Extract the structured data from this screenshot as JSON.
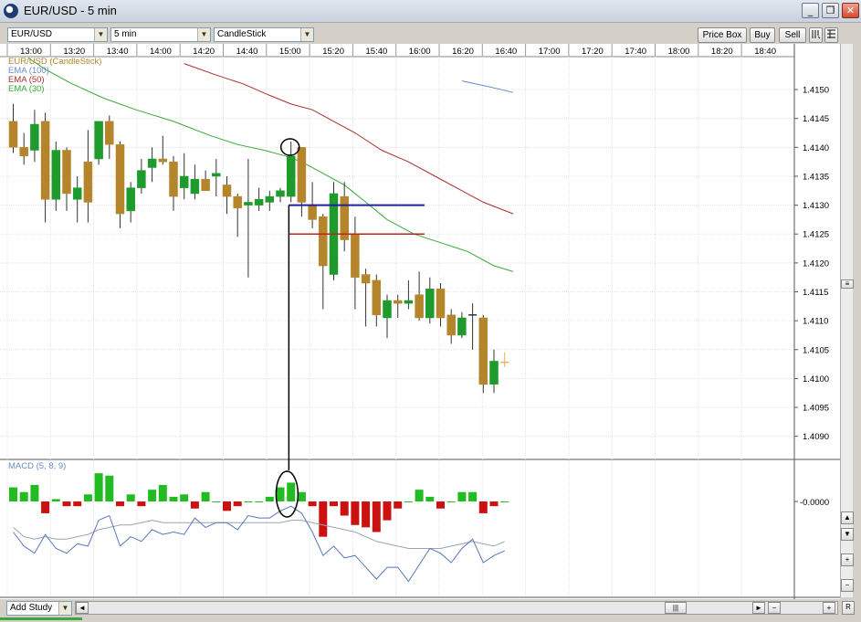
{
  "window": {
    "title": "EUR/USD - 5 min",
    "minimize": "_",
    "restore": "❐",
    "close": "✕"
  },
  "toolbar": {
    "symbol": "EUR/USD",
    "period": "5 min",
    "chart_type": "CandleStick",
    "price_box": "Price Box",
    "buy": "Buy",
    "sell": "Sell"
  },
  "footer": {
    "add_study": "Add Study",
    "scroll_left": "◄",
    "scroll_right": "►",
    "zoom_out": "−",
    "zoom_in": "+",
    "reset": "R",
    "grip": "|||"
  },
  "right_scroll": {
    "up": "▲",
    "down": "▼",
    "plus": "+",
    "minus": "−"
  },
  "colors": {
    "up_candle": "#1f9a2c",
    "down_candle": "#b5852c",
    "ema100": "#6a8cc8",
    "ema50": "#a8302a",
    "ema30": "#3aa83a",
    "macd_up": "#22bb22",
    "macd_down": "#cc1111",
    "support_line": "#22229a",
    "resist_line": "#bb2222"
  },
  "chart_data": {
    "type": "candlestick",
    "timeframe": "5 min",
    "x_ticks": [
      "13:00",
      "13:20",
      "13:40",
      "14:00",
      "14:20",
      "14:40",
      "15:00",
      "15:20",
      "15:40",
      "16:00",
      "16:20",
      "16:40",
      "17:00",
      "17:20",
      "17:40",
      "18:00",
      "18:20",
      "18:40"
    ],
    "y_ticks": [
      "1.4150",
      "1.4145",
      "1.4140",
      "1.4135",
      "1.4130",
      "1.4125",
      "1.4120",
      "1.4115",
      "1.4110",
      "1.4105",
      "1.4100",
      "1.4095",
      "1.4090"
    ],
    "ylim": [
      1.4086,
      1.41557
    ],
    "legend": [
      {
        "name": "EUR/USD (CandleStick)",
        "color": "#b5852c"
      },
      {
        "name": "EMA (100)",
        "color": "#6a8cc8"
      },
      {
        "name": "EMA (50)",
        "color": "#a8302a"
      },
      {
        "name": "EMA (30)",
        "color": "#3aa83a"
      }
    ],
    "candles": [
      {
        "o": 1.41445,
        "h": 1.41475,
        "l": 1.4139,
        "c": 1.414
      },
      {
        "o": 1.414,
        "h": 1.41425,
        "l": 1.4137,
        "c": 1.41385
      },
      {
        "o": 1.41395,
        "h": 1.41465,
        "l": 1.41375,
        "c": 1.4144
      },
      {
        "o": 1.41445,
        "h": 1.4146,
        "l": 1.4127,
        "c": 1.4131
      },
      {
        "o": 1.4131,
        "h": 1.4141,
        "l": 1.4129,
        "c": 1.41395
      },
      {
        "o": 1.41395,
        "h": 1.414,
        "l": 1.4129,
        "c": 1.4132
      },
      {
        "o": 1.4131,
        "h": 1.4135,
        "l": 1.4127,
        "c": 1.4133
      },
      {
        "o": 1.41375,
        "h": 1.4143,
        "l": 1.4127,
        "c": 1.41305
      },
      {
        "o": 1.4138,
        "h": 1.41445,
        "l": 1.4137,
        "c": 1.41445
      },
      {
        "o": 1.41445,
        "h": 1.41455,
        "l": 1.4138,
        "c": 1.41405
      },
      {
        "o": 1.41405,
        "h": 1.4141,
        "l": 1.4126,
        "c": 1.41285
      },
      {
        "o": 1.4129,
        "h": 1.4134,
        "l": 1.4127,
        "c": 1.4133
      },
      {
        "o": 1.4133,
        "h": 1.4138,
        "l": 1.4132,
        "c": 1.4136
      },
      {
        "o": 1.41365,
        "h": 1.414,
        "l": 1.4134,
        "c": 1.4138
      },
      {
        "o": 1.4138,
        "h": 1.4142,
        "l": 1.4137,
        "c": 1.41375
      },
      {
        "o": 1.41375,
        "h": 1.41385,
        "l": 1.4129,
        "c": 1.41315
      },
      {
        "o": 1.4133,
        "h": 1.4139,
        "l": 1.4131,
        "c": 1.4135
      },
      {
        "o": 1.4132,
        "h": 1.4137,
        "l": 1.4131,
        "c": 1.41345
      },
      {
        "o": 1.41345,
        "h": 1.4136,
        "l": 1.41325,
        "c": 1.41325
      },
      {
        "o": 1.4135,
        "h": 1.4138,
        "l": 1.41315,
        "c": 1.41355
      },
      {
        "o": 1.41335,
        "h": 1.4135,
        "l": 1.41285,
        "c": 1.41315
      },
      {
        "o": 1.41315,
        "h": 1.4132,
        "l": 1.41245,
        "c": 1.41295
      },
      {
        "o": 1.413,
        "h": 1.4138,
        "l": 1.41175,
        "c": 1.41305
      },
      {
        "o": 1.413,
        "h": 1.4133,
        "l": 1.4129,
        "c": 1.4131
      },
      {
        "o": 1.41305,
        "h": 1.41325,
        "l": 1.4129,
        "c": 1.41315
      },
      {
        "o": 1.41315,
        "h": 1.4133,
        "l": 1.41305,
        "c": 1.41325
      },
      {
        "o": 1.41315,
        "h": 1.4141,
        "l": 1.41305,
        "c": 1.41385
      },
      {
        "o": 1.414,
        "h": 1.414,
        "l": 1.4128,
        "c": 1.41305
      },
      {
        "o": 1.413,
        "h": 1.4134,
        "l": 1.4126,
        "c": 1.41275
      },
      {
        "o": 1.4128,
        "h": 1.41285,
        "l": 1.4112,
        "c": 1.41195
      },
      {
        "o": 1.4118,
        "h": 1.4134,
        "l": 1.4117,
        "c": 1.4132
      },
      {
        "o": 1.41315,
        "h": 1.4134,
        "l": 1.4122,
        "c": 1.4124
      },
      {
        "o": 1.4125,
        "h": 1.4128,
        "l": 1.4112,
        "c": 1.41175
      },
      {
        "o": 1.4118,
        "h": 1.4119,
        "l": 1.4109,
        "c": 1.41165
      },
      {
        "o": 1.4117,
        "h": 1.4118,
        "l": 1.4109,
        "c": 1.4111
      },
      {
        "o": 1.41105,
        "h": 1.41145,
        "l": 1.4107,
        "c": 1.41135
      },
      {
        "o": 1.41135,
        "h": 1.41145,
        "l": 1.41105,
        "c": 1.4113
      },
      {
        "o": 1.4113,
        "h": 1.4117,
        "l": 1.4112,
        "c": 1.41135
      },
      {
        "o": 1.41145,
        "h": 1.41185,
        "l": 1.411,
        "c": 1.41105
      },
      {
        "o": 1.41105,
        "h": 1.41175,
        "l": 1.41095,
        "c": 1.41155
      },
      {
        "o": 1.41155,
        "h": 1.41165,
        "l": 1.4109,
        "c": 1.41105
      },
      {
        "o": 1.4111,
        "h": 1.4112,
        "l": 1.4106,
        "c": 1.41075
      },
      {
        "o": 1.41075,
        "h": 1.41115,
        "l": 1.4107,
        "c": 1.41105
      },
      {
        "o": 1.4111,
        "h": 1.4113,
        "l": 1.4105,
        "c": 1.4111
      },
      {
        "o": 1.41105,
        "h": 1.4111,
        "l": 1.40975,
        "c": 1.4099
      },
      {
        "o": 1.4099,
        "h": 1.4105,
        "l": 1.40975,
        "c": 1.4103
      },
      {
        "o": 1.41028,
        "h": 1.41045,
        "l": 1.4102,
        "c": 1.41028
      }
    ],
    "ema30": [
      [
        1.4,
        1.41555
      ],
      [
        3.0,
        1.41535
      ],
      [
        5.5,
        1.4151
      ],
      [
        8.5,
        1.41485
      ],
      [
        11.5,
        1.41465
      ],
      [
        15,
        1.41445
      ],
      [
        18.5,
        1.4142
      ],
      [
        21,
        1.41405
      ],
      [
        23.5,
        1.41395
      ],
      [
        25.5,
        1.41385
      ],
      [
        27,
        1.41375
      ],
      [
        29,
        1.41355
      ],
      [
        31,
        1.41335
      ],
      [
        33,
        1.41305
      ],
      [
        35,
        1.41275
      ],
      [
        37.5,
        1.4125
      ],
      [
        40,
        1.41235
      ],
      [
        42.5,
        1.4122
      ],
      [
        45,
        1.41195
      ],
      [
        46.8,
        1.41185
      ]
    ],
    "ema50": [
      [
        16,
        1.41545
      ],
      [
        19,
        1.41525
      ],
      [
        21.5,
        1.4151
      ],
      [
        24,
        1.4149
      ],
      [
        26,
        1.41475
      ],
      [
        28,
        1.41465
      ],
      [
        30,
        1.41445
      ],
      [
        32,
        1.41425
      ],
      [
        34.5,
        1.41395
      ],
      [
        37,
        1.41375
      ],
      [
        39.5,
        1.4135
      ],
      [
        42,
        1.41325
      ],
      [
        44,
        1.41305
      ],
      [
        46.8,
        1.41285
      ]
    ],
    "ema100": [
      [
        42,
        1.41515
      ],
      [
        44.5,
        1.41505
      ],
      [
        46.8,
        1.41495
      ]
    ],
    "annotations": {
      "blue_line": {
        "price": 1.413,
        "from": 25.8,
        "to": 38.5
      },
      "red_line": {
        "price": 1.4125,
        "from": 25.8,
        "to": 38.5
      },
      "vertical_link_index": 25.8,
      "circle_candle_index": 26
    },
    "macd": {
      "label": "MACD (5, 8, 9)",
      "zero_tick": "-0.0000",
      "hist": [
        0.6,
        0.4,
        0.7,
        -0.5,
        0.1,
        -0.2,
        -0.2,
        0.3,
        1.2,
        1.1,
        -0.2,
        0.3,
        -0.2,
        0.5,
        0.7,
        0.2,
        0.3,
        -0.3,
        0.4,
        0.0,
        -0.4,
        -0.2,
        0.0,
        0.0,
        0.2,
        0.6,
        0.8,
        0.4,
        -0.2,
        -1.5,
        -0.2,
        -0.6,
        -1.0,
        -1.1,
        -1.3,
        -0.8,
        -0.3,
        0.0,
        0.5,
        0.2,
        -0.3,
        0.0,
        0.4,
        0.4,
        -0.5,
        -0.2,
        0.0
      ],
      "signal": [
        -1.1,
        -1.5,
        -1.6,
        -1.5,
        -1.6,
        -1.6,
        -1.5,
        -1.4,
        -1.2,
        -1.1,
        -1.0,
        -1.0,
        -0.9,
        -0.8,
        -0.9,
        -0.9,
        -0.9,
        -0.9,
        -0.9,
        -0.9,
        -0.9,
        -0.9,
        -0.9,
        -0.9,
        -0.9,
        -0.9,
        -0.8,
        -0.8,
        -0.9,
        -1.0,
        -1.1,
        -1.2,
        -1.3,
        -1.5,
        -1.7,
        -1.8,
        -1.9,
        -2.0,
        -2.0,
        -2.0,
        -2.0,
        -1.9,
        -1.8,
        -1.7,
        -1.8,
        -1.9,
        -1.7
      ],
      "macd": [
        -1.3,
        -1.9,
        -2.2,
        -1.4,
        -2.0,
        -2.2,
        -1.8,
        -1.9,
        -0.8,
        -0.6,
        -1.9,
        -1.5,
        -1.7,
        -1.2,
        -1.4,
        -1.3,
        -1.4,
        -0.7,
        -1.1,
        -0.9,
        -0.9,
        -1.2,
        -0.6,
        -0.7,
        -0.7,
        -0.4,
        -0.2,
        -0.5,
        -1.3,
        -2.3,
        -1.9,
        -2.4,
        -2.3,
        -2.8,
        -3.3,
        -2.8,
        -2.8,
        -3.4,
        -2.7,
        -2.0,
        -2.2,
        -2.6,
        -2.0,
        -1.6,
        -2.6,
        -2.3,
        -2.1
      ],
      "ylim": [
        -4.0,
        1.4
      ]
    }
  }
}
